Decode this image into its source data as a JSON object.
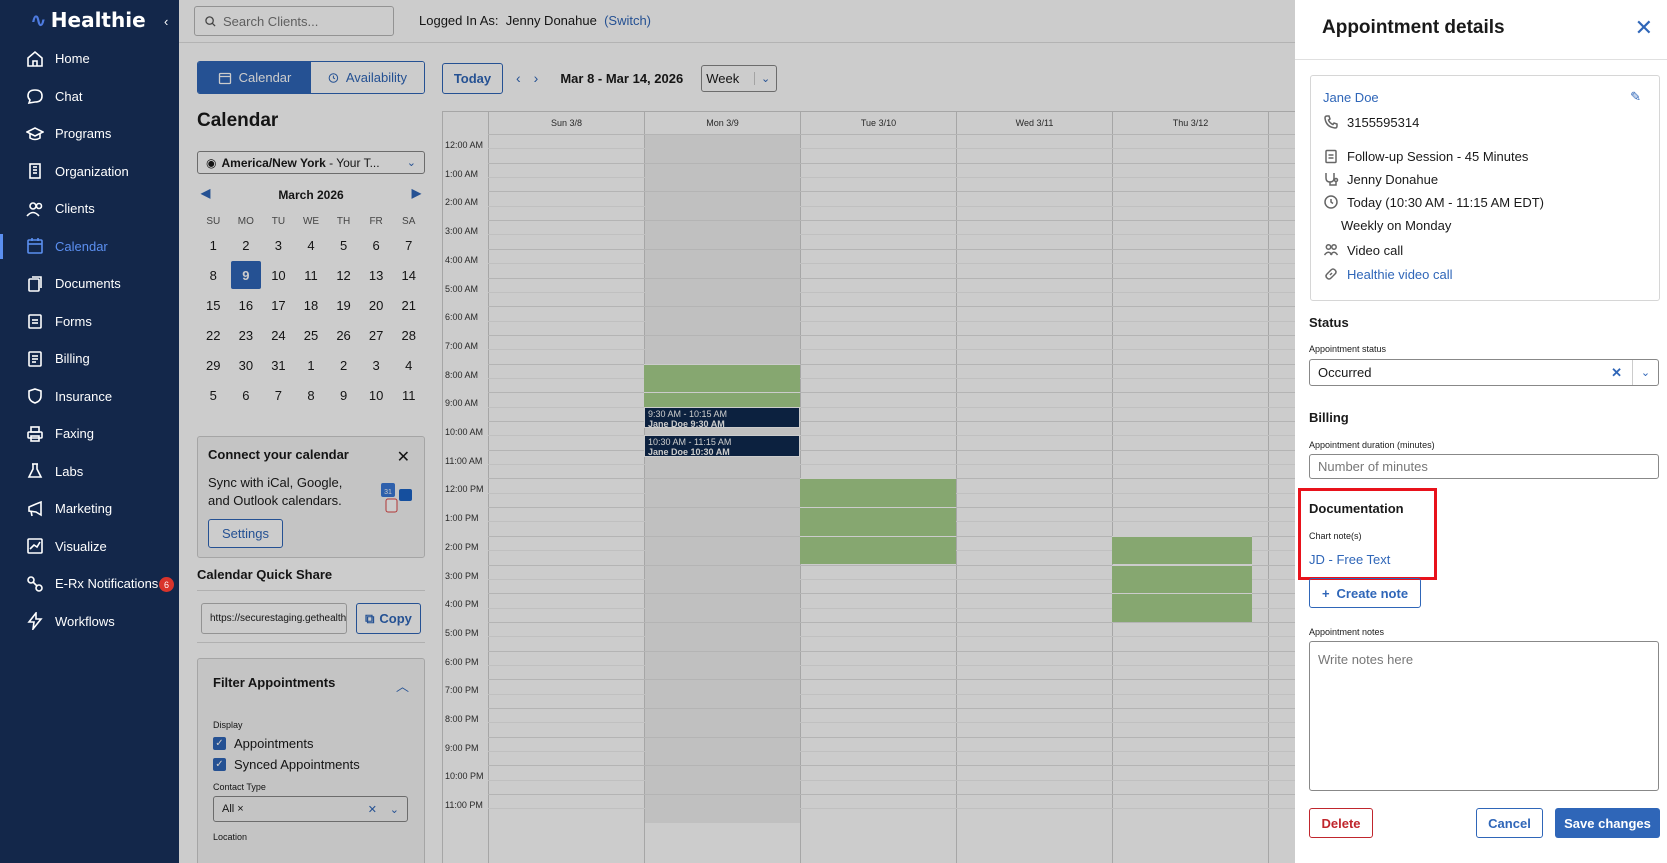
{
  "app": {
    "name": "Healthie"
  },
  "sidebar": {
    "items": [
      {
        "label": "Home",
        "icon": "home-icon"
      },
      {
        "label": "Chat",
        "icon": "chat-icon"
      },
      {
        "label": "Programs",
        "icon": "graduation-cap-icon"
      },
      {
        "label": "Organization",
        "icon": "building-icon"
      },
      {
        "label": "Clients",
        "icon": "users-icon"
      },
      {
        "label": "Calendar",
        "icon": "calendar-icon",
        "active": true
      },
      {
        "label": "Documents",
        "icon": "documents-icon"
      },
      {
        "label": "Forms",
        "icon": "clipboard-icon"
      },
      {
        "label": "Billing",
        "icon": "billing-icon"
      },
      {
        "label": "Insurance",
        "icon": "shield-icon"
      },
      {
        "label": "Faxing",
        "icon": "printer-icon"
      },
      {
        "label": "Labs",
        "icon": "flask-icon"
      },
      {
        "label": "Marketing",
        "icon": "megaphone-icon"
      },
      {
        "label": "Visualize",
        "icon": "chart-icon"
      },
      {
        "label": "E-Rx Notifications",
        "icon": "pills-icon",
        "badge": "6"
      },
      {
        "label": "Workflows",
        "icon": "lightning-icon"
      }
    ]
  },
  "topbar": {
    "search_placeholder": "Search Clients...",
    "logged_in_label": "Logged In As:",
    "user": "Jenny Donahue",
    "switch": "(Switch)"
  },
  "views": {
    "calendar": "Calendar",
    "availability": "Availability"
  },
  "calendar": {
    "title": "Calendar",
    "timezone_bold": "America/New York",
    "timezone_rest": " - Your T...",
    "month": "March 2026",
    "dow": [
      "SU",
      "MO",
      "TU",
      "WE",
      "TH",
      "FR",
      "SA"
    ],
    "weeks": [
      [
        "1",
        "2",
        "3",
        "4",
        "5",
        "6",
        "7"
      ],
      [
        "8",
        "9",
        "10",
        "11",
        "12",
        "13",
        "14"
      ],
      [
        "15",
        "16",
        "17",
        "18",
        "19",
        "20",
        "21"
      ],
      [
        "22",
        "23",
        "24",
        "25",
        "26",
        "27",
        "28"
      ],
      [
        "29",
        "30",
        "31",
        "1",
        "2",
        "3",
        "4"
      ],
      [
        "5",
        "6",
        "7",
        "8",
        "9",
        "10",
        "11"
      ]
    ],
    "selected_day": "9"
  },
  "connect": {
    "title": "Connect your calendar",
    "body": "Sync with iCal, Google, and Outlook calendars.",
    "button": "Settings"
  },
  "quick_share": {
    "title": "Calendar Quick Share",
    "url": "https://securestaging.gethealthie.com",
    "copy": "Copy"
  },
  "filter": {
    "title": "Filter Appointments",
    "display_label": "Display",
    "opt1": "Appointments",
    "opt2": "Synced Appointments",
    "contact_type_label": "Contact Type",
    "contact_type_value": "All",
    "location_label": "Location"
  },
  "toolbar": {
    "today": "Today",
    "range": "Mar 8 - Mar 14, 2026",
    "view": "Week"
  },
  "week": {
    "days": [
      "Sun 3/8",
      "Mon 3/9",
      "Tue 3/10",
      "Wed 3/11",
      "Thu 3/12"
    ],
    "hours": [
      "12:00 AM",
      "1:00 AM",
      "2:00 AM",
      "3:00 AM",
      "4:00 AM",
      "5:00 AM",
      "6:00 AM",
      "7:00 AM",
      "8:00 AM",
      "9:00 AM",
      "10:00 AM",
      "11:00 AM",
      "12:00 PM",
      "1:00 PM",
      "2:00 PM",
      "3:00 PM",
      "4:00 PM",
      "5:00 PM",
      "6:00 PM",
      "7:00 PM",
      "8:00 PM",
      "9:00 PM",
      "10:00 PM",
      "11:00 PM"
    ],
    "appointments": [
      {
        "time": "9:30 AM - 10:15 AM",
        "title": "Jane Doe 9:30 AM"
      },
      {
        "time": "10:30 AM - 11:15 AM",
        "title": "Jane Doe 10:30 AM"
      }
    ]
  },
  "panel": {
    "title": "Appointment details",
    "client_name": "Jane Doe",
    "phone": "3155595314",
    "appt_type": "Follow-up Session - 45 Minutes",
    "provider": "Jenny Donahue",
    "when": "Today (10:30 AM - 11:15 AM EDT)",
    "recurrence": "Weekly on Monday",
    "contact": "Video call",
    "video_link": "Healthie video call",
    "status_section": "Status",
    "status_label": "Appointment status",
    "status_value": "Occurred",
    "billing_section": "Billing",
    "duration_label": "Appointment duration (minutes)",
    "duration_placeholder": "Number of minutes",
    "documentation_section": "Documentation",
    "chart_notes_label": "Chart note(s)",
    "chart_note": "JD - Free Text",
    "create_note": "Create note",
    "notes_label": "Appointment notes",
    "notes_placeholder": "Write notes here",
    "delete": "Delete",
    "cancel": "Cancel",
    "save": "Save changes"
  }
}
